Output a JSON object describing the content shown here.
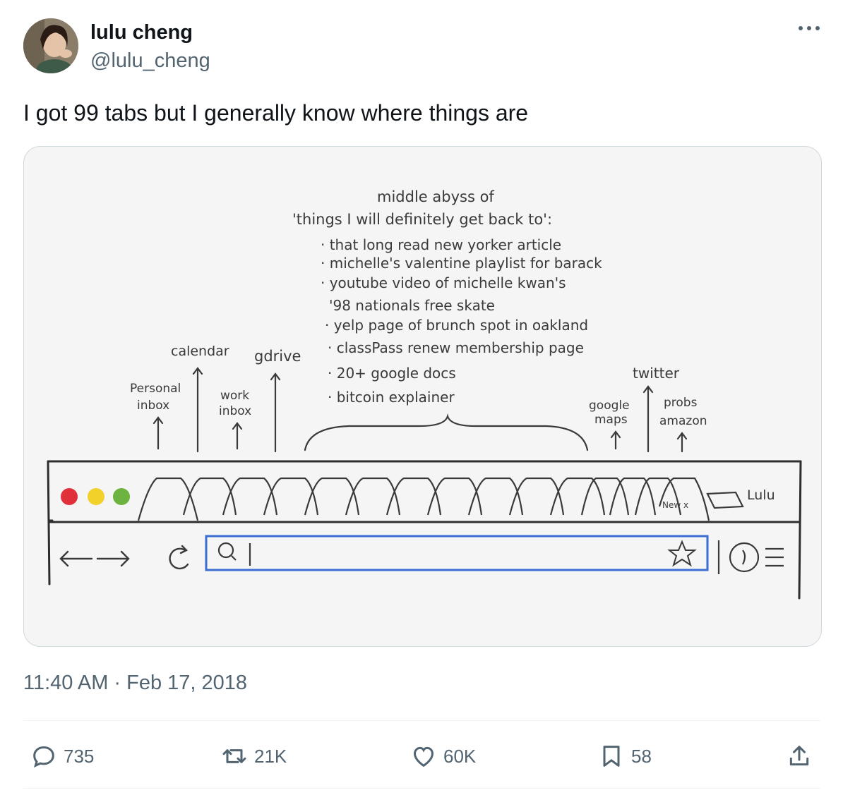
{
  "author": {
    "display_name": "lulu cheng",
    "handle": "@lulu_cheng"
  },
  "tweet": {
    "text": "I got 99 tabs but I generally know where things are",
    "timestamp": "11:40 AM · Feb 17, 2018"
  },
  "actions": {
    "replies": "735",
    "retweets": "21K",
    "likes": "60K",
    "bookmarks": "58"
  },
  "drawing": {
    "heading_line1": "middle abyss of",
    "heading_line2": "'things I will definitely get back to':",
    "items": [
      "· that long read new yorker article",
      "· michelle's valentine playlist for barack",
      "· youtube video of michelle kwan's",
      "'98 nationals free skate",
      "· yelp page of brunch spot in oakland",
      "· classPass renew membership page",
      "· 20+ google docs",
      "· bitcoin explainer"
    ],
    "labels": {
      "calendar": "calendar",
      "gdrive": "gdrive",
      "personal_inbox_1": "Personal",
      "personal_inbox_2": "inbox",
      "work_inbox_1": "work",
      "work_inbox_2": "inbox",
      "twitter": "twitter",
      "google_maps_1": "google",
      "google_maps_2": "maps",
      "probs_amazon_1": "probs",
      "probs_amazon_2": "amazon",
      "new_tab": "New x",
      "profile": "Lulu"
    },
    "traffic_light_colors": [
      "#e0303a",
      "#f2d12a",
      "#6db33f"
    ]
  },
  "colors": {
    "secondary_text": "#536471",
    "address_bar_outline": "#3a6fd0"
  }
}
